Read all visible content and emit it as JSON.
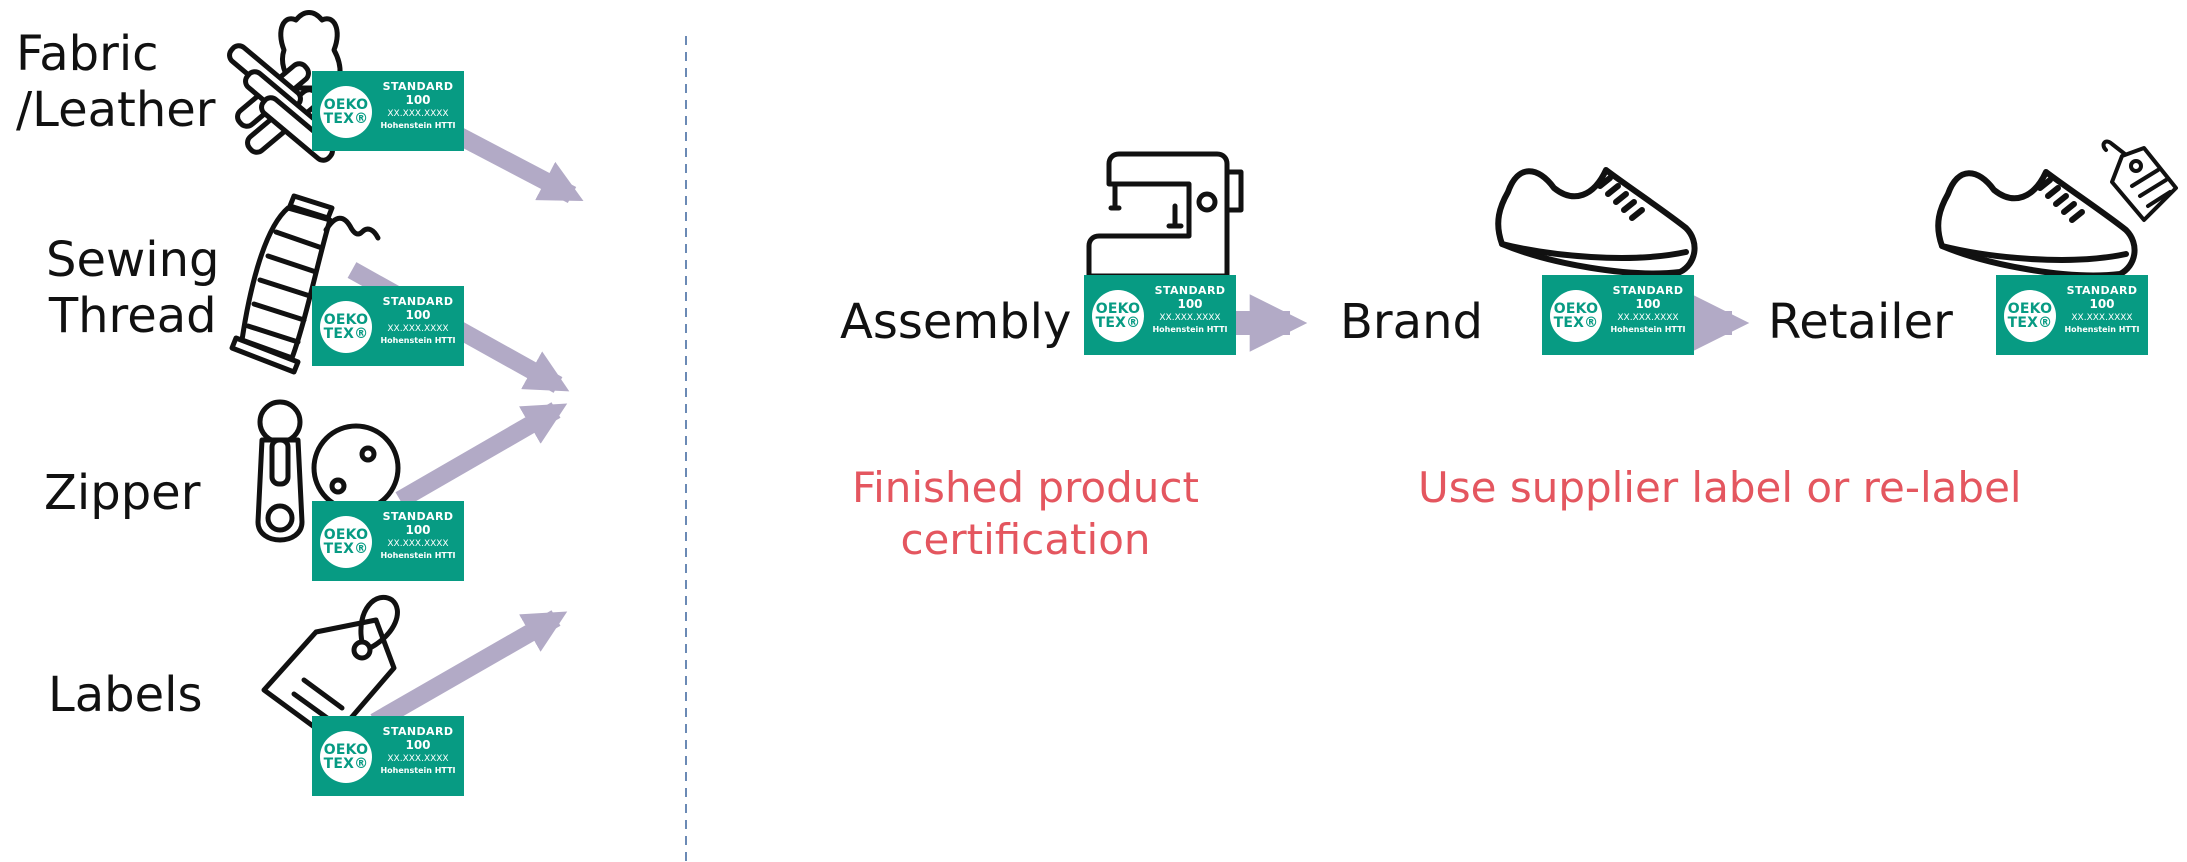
{
  "colors": {
    "badge_green": "#079b83",
    "arrow": "#b2aac6",
    "note_red": "#e4565f",
    "divider": "#6b8ab5",
    "icon_stroke": "#111111"
  },
  "badge": {
    "logo_line1": "OEKO",
    "logo_line2": "TEX®",
    "standard": "STANDARD",
    "number": "100",
    "code": "XX.XXX.XXXX",
    "institute": "Hohenstein HTTI"
  },
  "components": {
    "fabric_line1": "Fabric",
    "fabric_line2": "/Leather",
    "thread_line1": "Sewing",
    "thread_line2": "Thread",
    "zipper": "Zipper",
    "labels": "Labels"
  },
  "chain": {
    "assembly": "Assembly",
    "brand": "Brand",
    "retailer": "Retailer"
  },
  "notes": {
    "finished_line1": "Finished product",
    "finished_line2": "certification",
    "supplier": "Use supplier label or re-label"
  },
  "icons": {
    "fabric": "fabric-leather-icon",
    "thread": "thread-spool-icon",
    "zipper": "zipper-button-icon",
    "labels": "hang-tag-icon",
    "assembly": "sewing-machine-icon",
    "brand": "shoe-icon",
    "retailer": "shoe-with-tag-icon"
  }
}
